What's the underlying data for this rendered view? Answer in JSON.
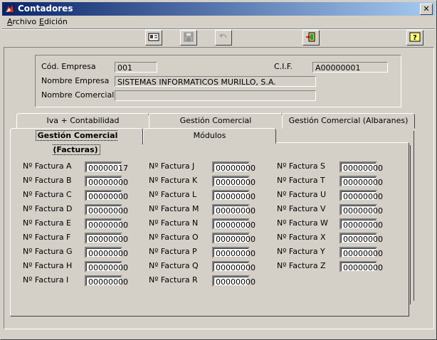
{
  "window": {
    "title": "Contadores"
  },
  "menu": {
    "archivo": "Archivo",
    "edicion": "Edición"
  },
  "toolbar": {
    "buttons": [
      {
        "name": "id-card-icon",
        "enabled": true
      },
      {
        "name": "save-icon",
        "enabled": false
      },
      {
        "name": "undo-icon",
        "enabled": false
      },
      {
        "name": "exit-icon",
        "enabled": true
      },
      {
        "name": "help-icon",
        "enabled": true
      }
    ]
  },
  "header": {
    "cod_empresa_label": "Cód. Empresa",
    "cod_empresa_value": "001",
    "cif_label": "C.I.F.",
    "cif_value": "A00000001",
    "nombre_empresa_label": "Nombre Empresa",
    "nombre_empresa_value": "SISTEMAS INFORMATICOS MURILLO, S.A.",
    "nombre_comercial_label": "Nombre Comercial",
    "nombre_comercial_value": ""
  },
  "tabs": {
    "row1": [
      "Iva + Contabilidad",
      "Gestión Comercial",
      "Gestión Comercial  (Albaranes)"
    ],
    "row2": [
      "Gestión Comercial  (Facturas)",
      "Módulos"
    ]
  },
  "facturas": {
    "col1": [
      {
        "label": "Nº Factura  A",
        "value": "00000017"
      },
      {
        "label": "Nº Factura  B",
        "value": "00000000"
      },
      {
        "label": "Nº Factura  C",
        "value": "00000000"
      },
      {
        "label": "Nº Factura  D",
        "value": "00000000"
      },
      {
        "label": "Nº Factura  E",
        "value": "00000000"
      },
      {
        "label": "Nº Factura  F",
        "value": "00000000"
      },
      {
        "label": "Nº Factura  G",
        "value": "00000000"
      },
      {
        "label": "Nº Factura  H",
        "value": "00000000"
      },
      {
        "label": "Nº Factura  I",
        "value": "00000000"
      }
    ],
    "col2": [
      {
        "label": "Nº Factura  J",
        "value": "00000000"
      },
      {
        "label": "Nº Factura  K",
        "value": "00000000"
      },
      {
        "label": "Nº Factura  L",
        "value": "00000000"
      },
      {
        "label": "Nº Factura  M",
        "value": "00000000"
      },
      {
        "label": "Nº Factura  N",
        "value": "00000000"
      },
      {
        "label": "Nº Factura  O",
        "value": "00000000"
      },
      {
        "label": "Nº Factura  P",
        "value": "00000000"
      },
      {
        "label": "Nº Factura  Q",
        "value": "00000000"
      },
      {
        "label": "Nº Factura  R",
        "value": "00000000"
      }
    ],
    "col3": [
      {
        "label": "Nº Factura  S",
        "value": "00000000"
      },
      {
        "label": "Nº Factura  T",
        "value": "00000000"
      },
      {
        "label": "Nº Factura  U",
        "value": "00000000"
      },
      {
        "label": "Nº Factura  V",
        "value": "00000000"
      },
      {
        "label": "Nº Factura  W",
        "value": "00000000"
      },
      {
        "label": "Nº Factura  X",
        "value": "00000000"
      },
      {
        "label": "Nº Factura  Y",
        "value": "00000000"
      },
      {
        "label": "Nº Factura  Z",
        "value": "00000000"
      }
    ]
  }
}
